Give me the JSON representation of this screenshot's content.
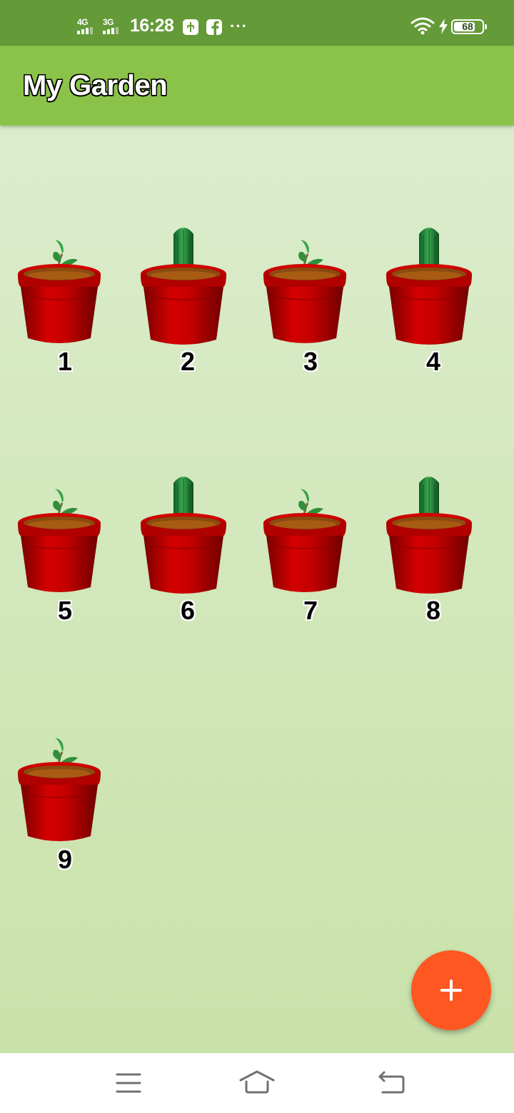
{
  "status_bar": {
    "network_1": "4G",
    "network_2": "3G",
    "time": "16:28",
    "more": "···",
    "battery_level": "68",
    "icons": [
      "signal-icon",
      "clock",
      "usb-debug-icon",
      "facebook-icon",
      "more-dots",
      "wifi-icon",
      "charging-icon",
      "battery-icon"
    ]
  },
  "app_bar": {
    "title": "My Garden"
  },
  "pots": [
    {
      "label": "1",
      "plant": "sprout"
    },
    {
      "label": "2",
      "plant": "cactus"
    },
    {
      "label": "3",
      "plant": "sprout"
    },
    {
      "label": "4",
      "plant": "cactus"
    },
    {
      "label": "5",
      "plant": "sprout"
    },
    {
      "label": "6",
      "plant": "cactus"
    },
    {
      "label": "7",
      "plant": "sprout"
    },
    {
      "label": "8",
      "plant": "cactus"
    },
    {
      "label": "9",
      "plant": "sprout"
    }
  ],
  "fab": {
    "icon": "plus-icon"
  },
  "nav_bar": {
    "icons": [
      "menu-icon",
      "home-icon",
      "back-icon"
    ]
  },
  "colors": {
    "status_bar": "#649a37",
    "app_bar": "#8bc34a",
    "background_top": "#dbeccc",
    "background_bottom": "#c9e2a9",
    "fab": "#ff5722",
    "pot": "#c00000"
  }
}
